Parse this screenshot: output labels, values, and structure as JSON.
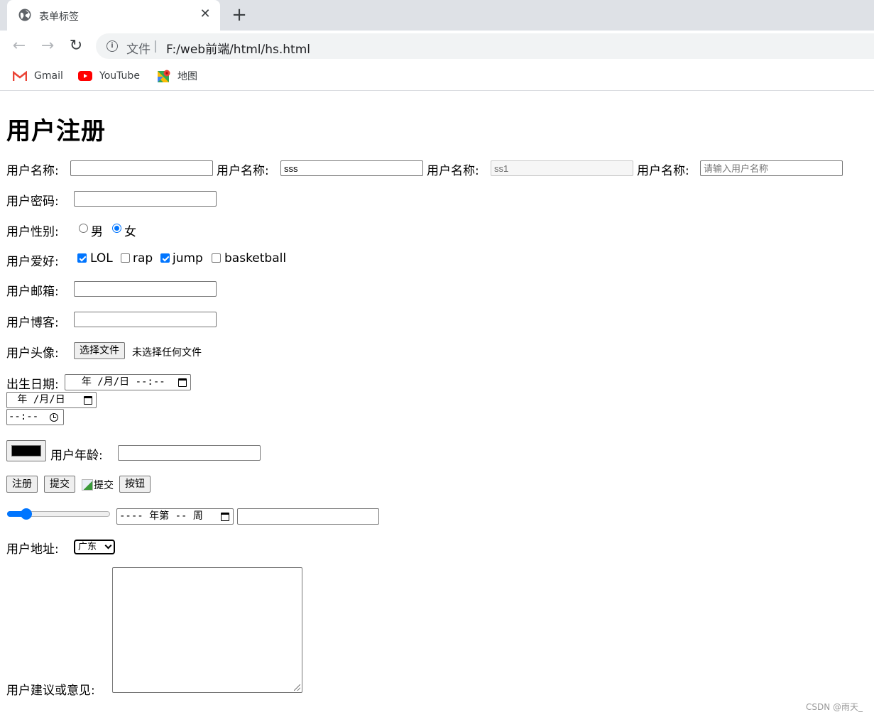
{
  "browser": {
    "tab": {
      "title": "表单标签",
      "icon": "globe-icon",
      "close": "✕"
    },
    "new_tab": "+",
    "nav": {
      "back": "←",
      "forward": "→",
      "reload": "↻"
    },
    "omnibox": {
      "info": "i",
      "scheme_label": "文件",
      "separator": "|",
      "url": "F:/web前端/html/hs.html"
    },
    "bookmarks": [
      {
        "label": "Gmail",
        "icon": "gmail-icon"
      },
      {
        "label": "YouTube",
        "icon": "youtube-icon"
      },
      {
        "label": "地图",
        "icon": "maps-icon"
      }
    ]
  },
  "form": {
    "title": "用户注册",
    "username_row": [
      {
        "label": "用户名称:",
        "value": "",
        "placeholder": "",
        "disabled": false
      },
      {
        "label": "用户名称:",
        "value": "sss",
        "placeholder": "",
        "disabled": false
      },
      {
        "label": "用户名称:",
        "value": "ss1",
        "placeholder": "",
        "disabled": true
      },
      {
        "label": "用户名称:",
        "value": "",
        "placeholder": "请输入用户名称",
        "disabled": false
      }
    ],
    "password": {
      "label": "用户密码:",
      "value": ""
    },
    "gender": {
      "label": "用户性别:",
      "options": [
        {
          "label": "男",
          "checked": false
        },
        {
          "label": "女",
          "checked": true
        }
      ]
    },
    "hobbies": {
      "label": "用户爱好:",
      "options": [
        {
          "label": "LOL",
          "checked": true
        },
        {
          "label": "rap",
          "checked": false
        },
        {
          "label": "jump",
          "checked": true
        },
        {
          "label": "basketball",
          "checked": false
        }
      ]
    },
    "email": {
      "label": "用户邮箱:",
      "value": ""
    },
    "blog": {
      "label": "用户博客:",
      "value": ""
    },
    "avatar": {
      "label": "用户头像:",
      "button": "选择文件",
      "status": "未选择任何文件"
    },
    "birthday": {
      "label": "出生日期:",
      "datetime_placeholder": "  年 /月/日 --:--",
      "date_placeholder": " 年 /月/日",
      "time_placeholder": "--:--"
    },
    "color": {
      "value": "#000000"
    },
    "age": {
      "label": "用户年龄:",
      "value": ""
    },
    "buttons": {
      "register": "注册",
      "submit": "提交",
      "image_submit_alt": "提交",
      "button": "按钮"
    },
    "range": {
      "value": 15,
      "min": 0,
      "max": 100
    },
    "week": {
      "placeholder": "---- 年第 -- 周"
    },
    "extra_input": {
      "value": ""
    },
    "address": {
      "label": "用户地址:",
      "selected": "广东"
    },
    "suggestion": {
      "label": "用户建议或意见:",
      "value": ""
    }
  },
  "watermark": "CSDN @雨天_"
}
